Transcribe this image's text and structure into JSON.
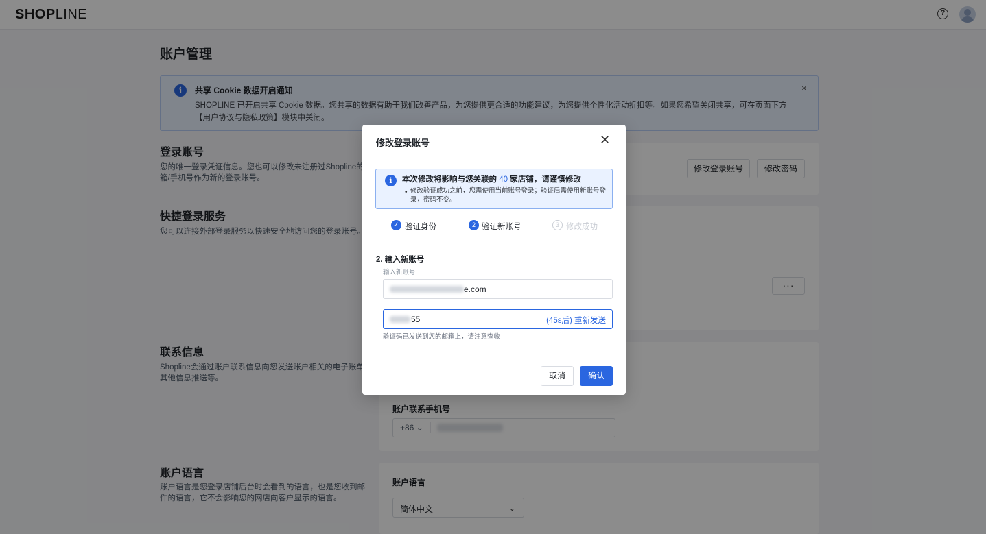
{
  "header": {
    "logo_bold": "SHOP",
    "logo_thin": "LINE",
    "help_glyph": "?"
  },
  "page": {
    "title": "账户管理"
  },
  "notice": {
    "title": "共享 Cookie 数据开启通知",
    "body": "SHOPLINE 已开启共享 Cookie 数据。您共享的数据有助于我们改善产品，为您提供更合适的功能建议，为您提供个性化活动折扣等。如果您希望关闭共享，可在页面下方【用户协议与隐私政策】模块中关闭。",
    "close_glyph": "×"
  },
  "sections": {
    "login_account": {
      "title": "登录账号",
      "desc": "您的唯一登录凭证信息。您也可以修改未注册过Shopline的邮箱/手机号作为新的登录账号。",
      "btn_change_account": "修改登录账号",
      "btn_change_password": "修改密码"
    },
    "quick_login": {
      "title": "快捷登录服务",
      "desc": "您可以连接外部登录服务以快速安全地访问您的登录账号。",
      "more_glyph": "···"
    },
    "contact": {
      "title": "联系信息",
      "desc": "Shopline会通过账户联系信息向您发送账户相关的电子账单或其他信息推送等。",
      "phone_label": "账户联系手机号",
      "country_code": "+86"
    },
    "language": {
      "title": "账户语言",
      "desc": "账户语言是您登录店铺后台时会看到的语言，也是您收到邮件的语言，它不会影响您的网店向客户显示的语言。",
      "field_label": "账户语言",
      "selected": "简体中文"
    }
  },
  "modal": {
    "title": "修改登录账号",
    "close_glyph": "✕",
    "warning": {
      "title_prefix": "本次修改将影响与您关联的",
      "store_count": "40",
      "title_suffix": "家店铺，请谨慎修改",
      "bullet": "•",
      "body": "修改验证成功之前，您需使用当前账号登录；验证后需使用新账号登录，密码不变。"
    },
    "steps": [
      {
        "index": "✓",
        "label": "验证身份",
        "state": "done"
      },
      {
        "index": "2",
        "label": "验证新账号",
        "state": "active"
      },
      {
        "index": "3",
        "label": "修改成功",
        "state": "pending"
      }
    ],
    "step_title": "2. 输入新账号",
    "new_account_label": "输入新账号",
    "new_account_suffix": "e.com",
    "code_suffix": "55",
    "resend_label": "(45s后) 重新发送",
    "hint": "验证码已发送到您的邮箱上，请注意查收",
    "cancel_label": "取消",
    "confirm_label": "确认"
  },
  "colors": {
    "primary": "#2a66e0",
    "overlay": "rgba(0,0,0,0.45)"
  }
}
